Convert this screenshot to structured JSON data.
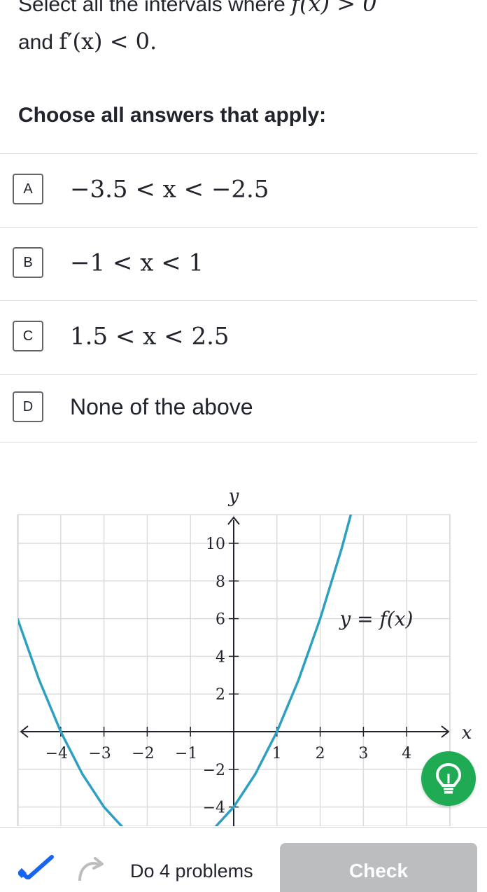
{
  "question": {
    "line1_prefix": "Select all the intervals where ",
    "line1_math": "f(x) > 0",
    "line2_prefix": "and ",
    "line2_math": "f′(x) < 0."
  },
  "prompt": "Choose all answers that apply:",
  "choices": [
    {
      "letter": "A",
      "text": "−3.5 < x < −2.5",
      "is_math": true
    },
    {
      "letter": "B",
      "text": "−1 < x < 1",
      "is_math": true
    },
    {
      "letter": "C",
      "text": "1.5 < x < 2.5",
      "is_math": true
    },
    {
      "letter": "D",
      "text": "None of the above",
      "is_math": false
    }
  ],
  "chart_data": {
    "type": "line",
    "title": "",
    "xlabel": "x",
    "ylabel": "y",
    "xlim": [
      -5,
      5
    ],
    "ylim": [
      -5,
      11
    ],
    "x_ticks": [
      -4,
      -3,
      -2,
      -1,
      1,
      2,
      3,
      4
    ],
    "x_tick_labels": [
      "−4",
      "−3",
      "−2",
      "−1",
      "1",
      "2",
      "3",
      "4"
    ],
    "y_ticks": [
      10,
      8,
      6,
      4,
      2,
      -2,
      -4
    ],
    "y_tick_labels": [
      "10",
      "8",
      "6",
      "4",
      "2",
      "−2",
      "−4"
    ],
    "grid": true,
    "series": [
      {
        "name": "y = f(x)",
        "color": "#2da0c2",
        "function": "(x+4)(x-1)",
        "x": [
          -5,
          -4.5,
          -4,
          -3.5,
          -3,
          -2.5,
          -2,
          -1.5,
          -1,
          -0.5,
          0,
          0.5,
          1,
          1.5,
          2,
          2.5,
          3,
          3.5
        ],
        "y": [
          6,
          2.75,
          0,
          -2.25,
          -4,
          -5.25,
          -6,
          -6.25,
          -6,
          -5.25,
          -4,
          -2.25,
          0,
          2.75,
          6,
          9.75,
          14,
          18.75
        ]
      }
    ],
    "annotation": "y = f(x)"
  },
  "hint_icon": "lightbulb-icon",
  "footer": {
    "progress_text": "Do 4 problems",
    "check_label": "Check"
  },
  "colors": {
    "curve": "#2da0c2",
    "hint_button": "#1fab54",
    "check_button": "#bbbdbf",
    "progress_icon": "#1865f2"
  }
}
